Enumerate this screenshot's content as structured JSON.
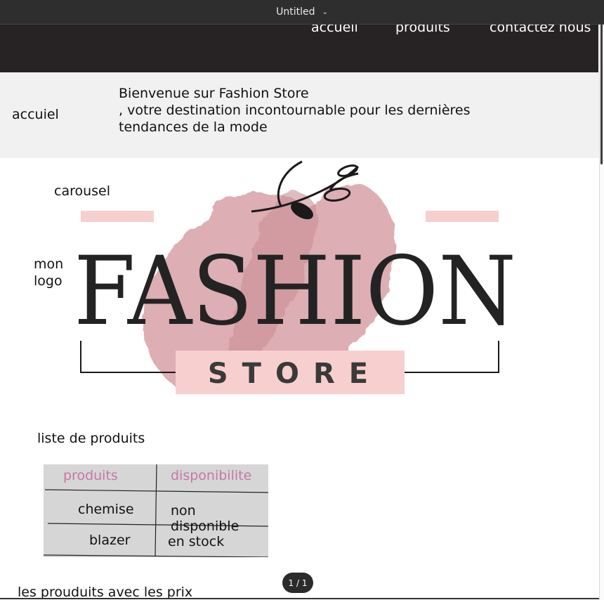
{
  "window": {
    "title": "Untitled"
  },
  "nav": {
    "links": [
      "accueil",
      "produits",
      "contactez nous"
    ]
  },
  "hero": {
    "side_label": "accuiel",
    "welcome_lines": [
      "Bienvenue sur Fashion Store",
      ", votre destination incontournable pour les dernières",
      "tendances de la mode"
    ]
  },
  "sections": {
    "carousel_label": "carousel",
    "logo_label_lines": [
      "mon",
      "logo"
    ],
    "products_title": "liste de produits",
    "bottom_text": "les prouduits  avec les prix"
  },
  "logo": {
    "word": "FASHION",
    "sub": "STORE",
    "colors": {
      "brush": "#d9a5ab",
      "pink_bar": "#f8cfcf",
      "text": "#232323"
    }
  },
  "table": {
    "headers": [
      "produits",
      "disponibilite"
    ],
    "rows": [
      [
        "chemise",
        "non disponible"
      ],
      [
        "blazer",
        "en stock"
      ]
    ]
  },
  "pager": {
    "label": "1 / 1"
  },
  "colors": {
    "navbar": "#272224",
    "hero_bg": "#f1f1f1",
    "header_text": "#c776a8",
    "table_bg": "#d6d6d6"
  }
}
